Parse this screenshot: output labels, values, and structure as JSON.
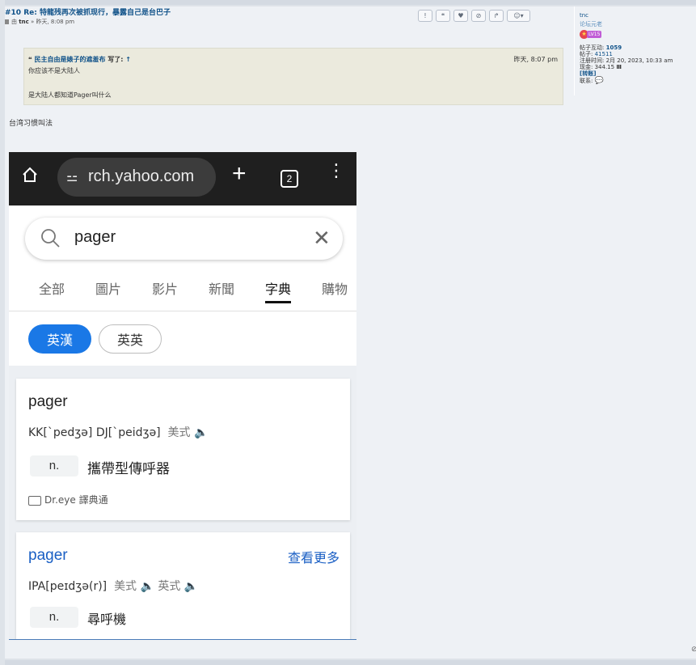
{
  "post": {
    "title": "#10 Re: 特龍残再次被抓现行，暴露自己是台巴子",
    "by_prefix": "由",
    "author": "tnc",
    "time": "» 昨天, 8:08 pm",
    "body_text": "台湾习惯叫法"
  },
  "actions": [
    {
      "name": "report-button",
      "glyph": "!"
    },
    {
      "name": "quote-button",
      "glyph": "❝"
    },
    {
      "name": "thanks-button",
      "glyph": "♥"
    },
    {
      "name": "warn-button",
      "glyph": "⊘"
    },
    {
      "name": "share-button",
      "glyph": "↱"
    },
    {
      "name": "reaction-button",
      "glyph": "☺▾"
    }
  ],
  "profile": {
    "username": "tnc",
    "rank": "论坛元老",
    "level": "LV15",
    "interactions_label": "帖子互动:",
    "interactions_value": "1059",
    "posts_label": "帖子:",
    "posts_value": "41511",
    "registered_label": "注册时间:",
    "registered_value": "2月 20, 2023, 10:33 am",
    "cash_label": "现金:",
    "cash_value": "344.15",
    "transfer_link": "[转账]",
    "contact_label": "联系:"
  },
  "quote": {
    "author": "民主自由是婊子的遮羞布",
    "wrote": "写了:",
    "arrow": "↑",
    "time": "昨天, 8:07 pm",
    "line1": "你应该不是大陆人",
    "line2": "是大陆人都知道Pager叫什么"
  },
  "embedded": {
    "url": "rch.yahoo.com",
    "tab_count": "2",
    "search_query": "pager",
    "nav_tabs": [
      "全部",
      "圖片",
      "影片",
      "新聞",
      "字典",
      "購物"
    ],
    "active_tab": "字典",
    "dict_pills": [
      "英漢",
      "英英"
    ],
    "card1": {
      "word": "pager",
      "kk": "KK[ˋpedʒə]",
      "dj": "DJ[ˋpeidʒə]",
      "us_label": "美式",
      "pos": "n.",
      "meaning": "攜帶型傳呼器",
      "source": "Dr.eye 譯典通"
    },
    "card2": {
      "word": "pager",
      "more": "查看更多",
      "ipa": "IPA[peɪdʒə(r)]",
      "us_label": "美式",
      "uk_label": "英式",
      "pos": "n.",
      "meaning": "尋呼機"
    }
  },
  "colors": {
    "link": "#105289",
    "quote_bg": "#ebeadd",
    "post_bg": "#eef1f5",
    "pill_active": "#1a78e6"
  }
}
